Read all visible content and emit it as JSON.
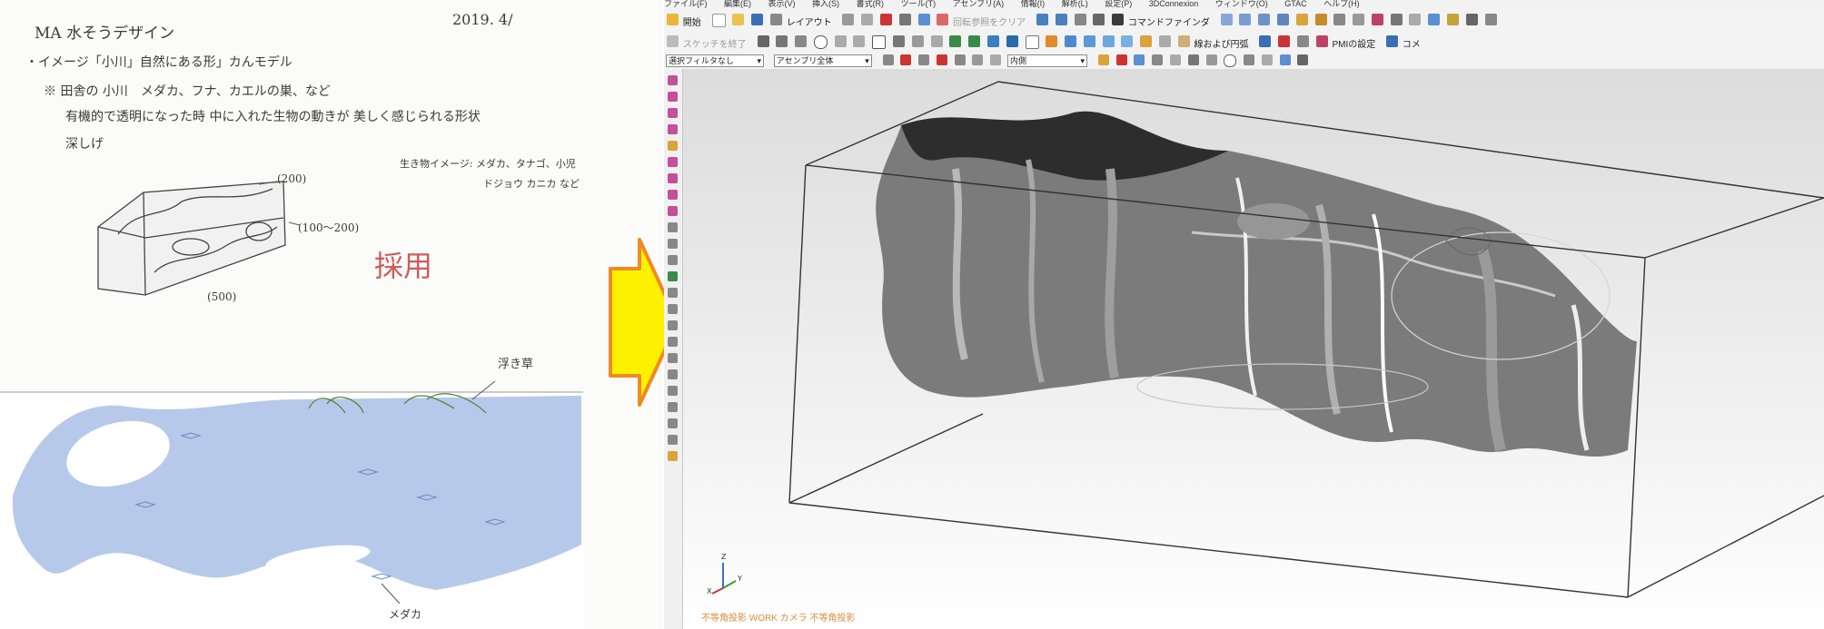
{
  "sketch": {
    "title": "MA 水そうデザイン",
    "date": "2019. 4/",
    "image_line": "・イメージ「小川」自然にある形」カんモデル",
    "note_line": "※ 田舎の 小川　メダカ、フナ、カエルの巣、など",
    "desc_line": "有機的で透明になった時 中に入れた生物の動きが 美しく感じられる形状",
    "depth_line": "深しげ",
    "creatures_line1": "生き物イメージ: メダカ、タナゴ、小児",
    "creatures_line2": "ドジョウ カニカ など",
    "dim_width": "(200)",
    "dim_height": "(100～200)",
    "dim_length": "(500)",
    "adopted_stamp": "採用",
    "floating_grass_label": "浮き草",
    "medaka_label": "メダカ"
  },
  "cad": {
    "menu": [
      "ファイル(F)",
      "編集(E)",
      "表示(V)",
      "挿入(S)",
      "書式(R)",
      "ツール(T)",
      "アセンブリ(A)",
      "情報(I)",
      "解析(L)",
      "設定(P)",
      "3DConnexion",
      "ウィンドウ(O)",
      "GTAC",
      "ヘルプ(H)"
    ],
    "toolbar1": {
      "start": "開始",
      "layout": "レイアウト",
      "clear_ref": "回転参照をクリア",
      "command_finder": "コマンドファインダ"
    },
    "toolbar2": {
      "finish_sketch": "スケッチを終了",
      "line_arc": "線および円弧",
      "pmi": "PMIの設定",
      "comment": "コメ"
    },
    "toolbar3": {
      "selection_filter": "選択フィルタなし",
      "assembly_scope": "アセンブリ全体",
      "inside": "内側"
    },
    "viewport_status": "不等角投影 WORK カメラ 不等角投影",
    "axis_x": "X",
    "axis_y": "Y",
    "axis_z": "Z"
  },
  "colors": {
    "arrow_fill": "#fff200",
    "arrow_stroke": "#f08a24",
    "sketch_blue": "#9fb7e0",
    "status_orange": "#e08a3a"
  }
}
